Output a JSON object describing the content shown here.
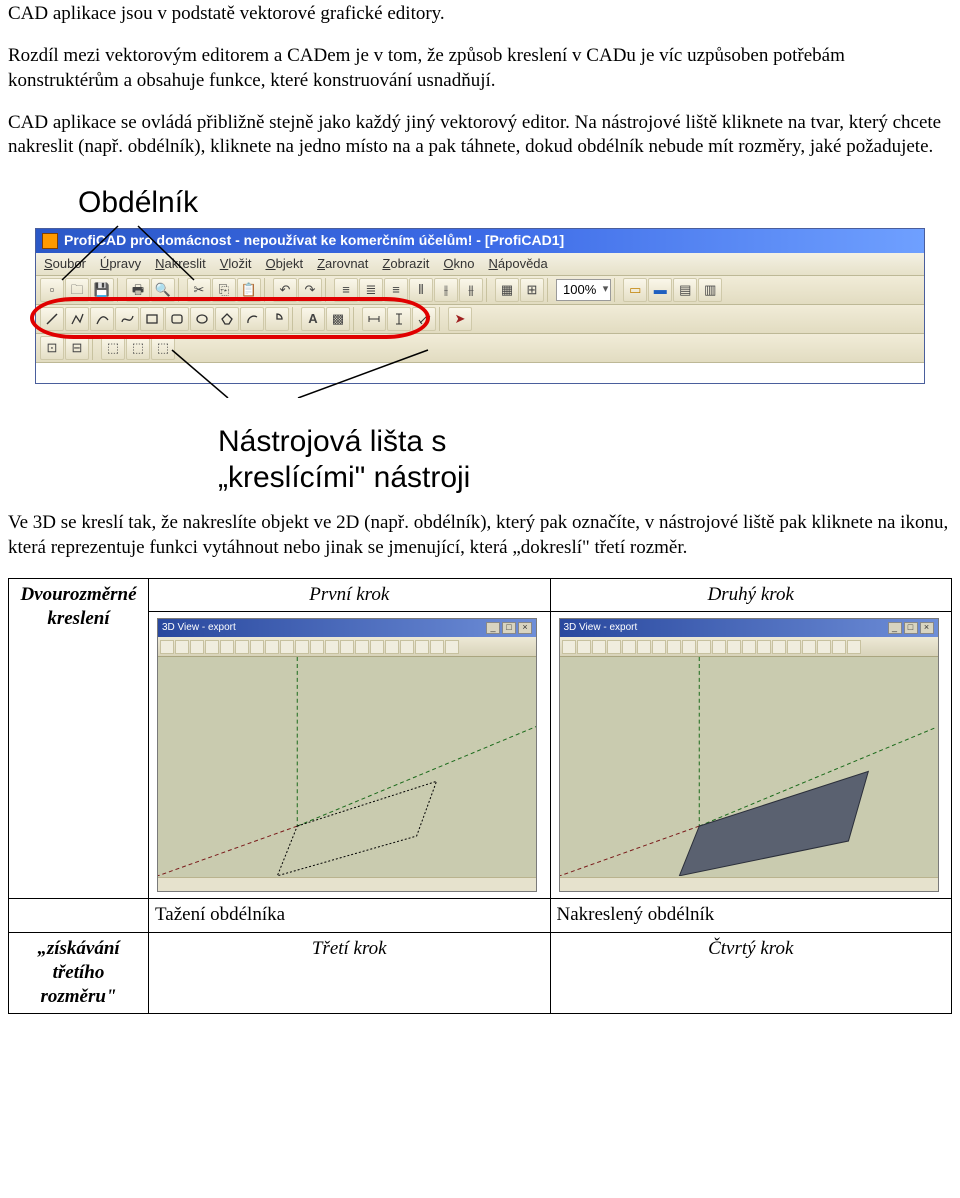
{
  "paragraphs": {
    "p1": "CAD aplikace jsou v podstatě vektorové grafické editory.",
    "p2": "Rozdíl mezi vektorovým editorem a CADem je v tom, že způsob kreslení v CADu je víc uzpůsoben potřebám konstruktérům a obsahuje funkce, které konstruování usnadňují.",
    "p3": "CAD aplikace se ovládá přibližně stejně jako každý jiný vektorový editor. Na nástrojové liště kliknete na tvar, který chcete nakreslit (např. obdélník), kliknete na jedno místo na a pak táhnete, dokud obdélník nebude mít rozměry, jaké požadujete.",
    "p4": "Ve 3D se kreslí tak, že nakreslíte objekt ve 2D (např. obdélník), který pak označíte, v nástrojové liště pak kliknete na ikonu, která reprezentuje funkci vytáhnout nebo jinak se jmenující, která „dokreslí\" třetí rozměr."
  },
  "callouts": {
    "obdelnik": "Obdélník",
    "toolbar_line1": "Nástrojová lišta s",
    "toolbar_line2": "„kreslícími\" nástroji"
  },
  "proficad": {
    "title": "ProfiCAD pro domácnost - nepoužívat ke komerčním účelům! - [ProfiCAD1]",
    "menus": [
      "Soubor",
      "Úpravy",
      "Nakreslit",
      "Vložit",
      "Objekt",
      "Zarovnat",
      "Zobrazit",
      "Okno",
      "Nápověda"
    ],
    "zoom": "100%"
  },
  "steps": {
    "row1_label": "Dvourozměrné kreslení",
    "row2_label": "„získávání třetího rozměru\"",
    "col1_hdr": "První krok",
    "col2_hdr": "Druhý krok",
    "caption1": "Tažení obdélníka",
    "caption2": "Nakreslený obdélník",
    "col3_hdr": "Třetí krok",
    "col4_hdr": "Čtvrtý krok",
    "app_title": "3D View - export"
  }
}
